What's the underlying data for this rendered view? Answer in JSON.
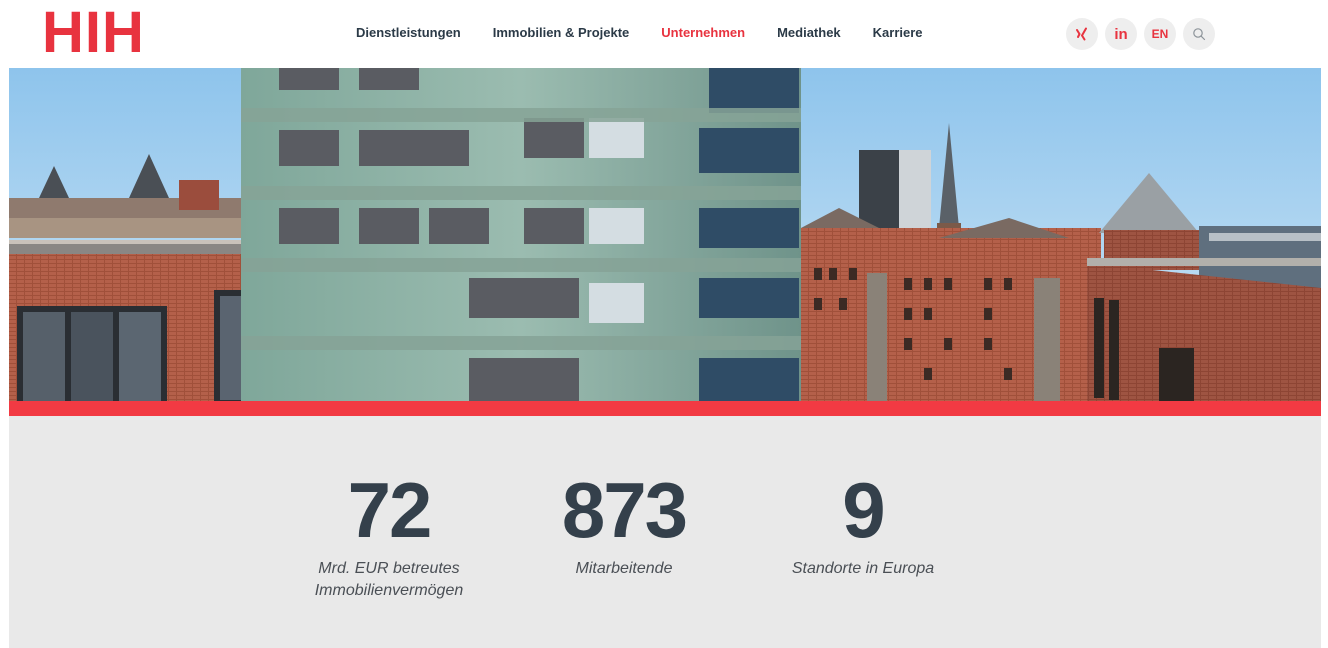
{
  "header": {
    "logo_text": "HIH",
    "nav": [
      {
        "label": "Dienstleistungen",
        "active": false
      },
      {
        "label": "Immobilien & Projekte",
        "active": false
      },
      {
        "label": "Unternehmen",
        "active": true
      },
      {
        "label": "Mediathek",
        "active": false
      },
      {
        "label": "Karriere",
        "active": false
      }
    ],
    "icons": {
      "xing": "xing-icon",
      "linkedin": "linkedin-icon",
      "search": "search-icon"
    },
    "linkedin_text": "in",
    "language_label": "EN"
  },
  "colors": {
    "brand_red": "#e8333f",
    "band_red": "#f23a43",
    "text_dark": "#34404b",
    "stats_bg": "#e9e9e9"
  },
  "stats": [
    {
      "value": "72",
      "label_line1": "Mrd. EUR betreutes",
      "label_line2": "Immobilienvermögen"
    },
    {
      "value": "873",
      "label_line1": "Mitarbeitende",
      "label_line2": ""
    },
    {
      "value": "9",
      "label_line1": "Standorte in Europa",
      "label_line2": ""
    }
  ]
}
